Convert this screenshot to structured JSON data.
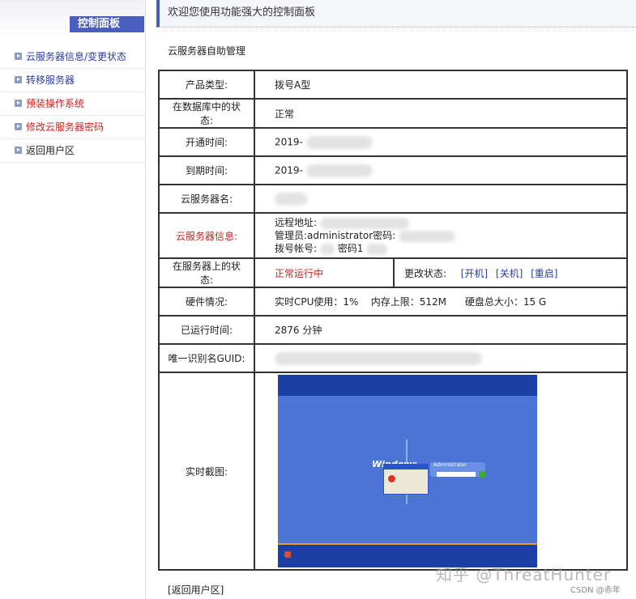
{
  "sidebar": {
    "title": "控制面板",
    "items": [
      {
        "label": "云服务器信息/变更状态",
        "color": "#2a3fa0"
      },
      {
        "label": "转移服务器",
        "color": "#2a3fa0"
      },
      {
        "label": "预装操作系统",
        "color": "#cc2222"
      },
      {
        "label": "修改云服务器密码",
        "color": "#cc2222"
      },
      {
        "label": "返回用户区",
        "color": "#222222"
      }
    ]
  },
  "header": {
    "welcome": "欢迎您使用功能强大的控制面板"
  },
  "main": {
    "section_title": "云服务器自助管理",
    "rows": {
      "product_type": {
        "label": "产品类型:",
        "value": "拨号A型"
      },
      "db_status": {
        "label": "在数据库中的状态:",
        "value": "正常"
      },
      "open_time": {
        "label": "开通时间:",
        "value": "2019-"
      },
      "expire_time": {
        "label": "到期时间:",
        "value": "2019-"
      },
      "server_name": {
        "label": "云服务器名:"
      },
      "server_info": {
        "label": "云服务器信息:",
        "remote_label": "远程地址:",
        "admin_label": "管理员:administrator密码:",
        "dial_label": "拨号帐号:",
        "dial_pwd_label": "密码1"
      },
      "server_status": {
        "label": "在服务器上的状态:",
        "value": "正常运行中",
        "change_label": "更改状态:",
        "actions": [
          "[开机]",
          "[关机]",
          "[重启]"
        ]
      },
      "hardware": {
        "label": "硬件情况:",
        "value": "实时CPU使用：1%    内存上限：512M      硬盘总大小：15 G"
      },
      "uptime": {
        "label": "已运行时间:",
        "value": "2876 分钟"
      },
      "guid": {
        "label": "唯一识别名GUID:"
      },
      "screenshot": {
        "label": "实时截图:",
        "logo_text": "Windows",
        "user_text": "Administrator"
      }
    },
    "back_link": "[返回用户区]"
  },
  "watermark": "知乎 @ThreatHunter",
  "credit": "CSDN @赤年",
  "colors": {
    "accent": "#4a5fbd",
    "link": "#2a3fa0",
    "alert": "#cc2222",
    "screen_bg": "#4c74d4"
  }
}
